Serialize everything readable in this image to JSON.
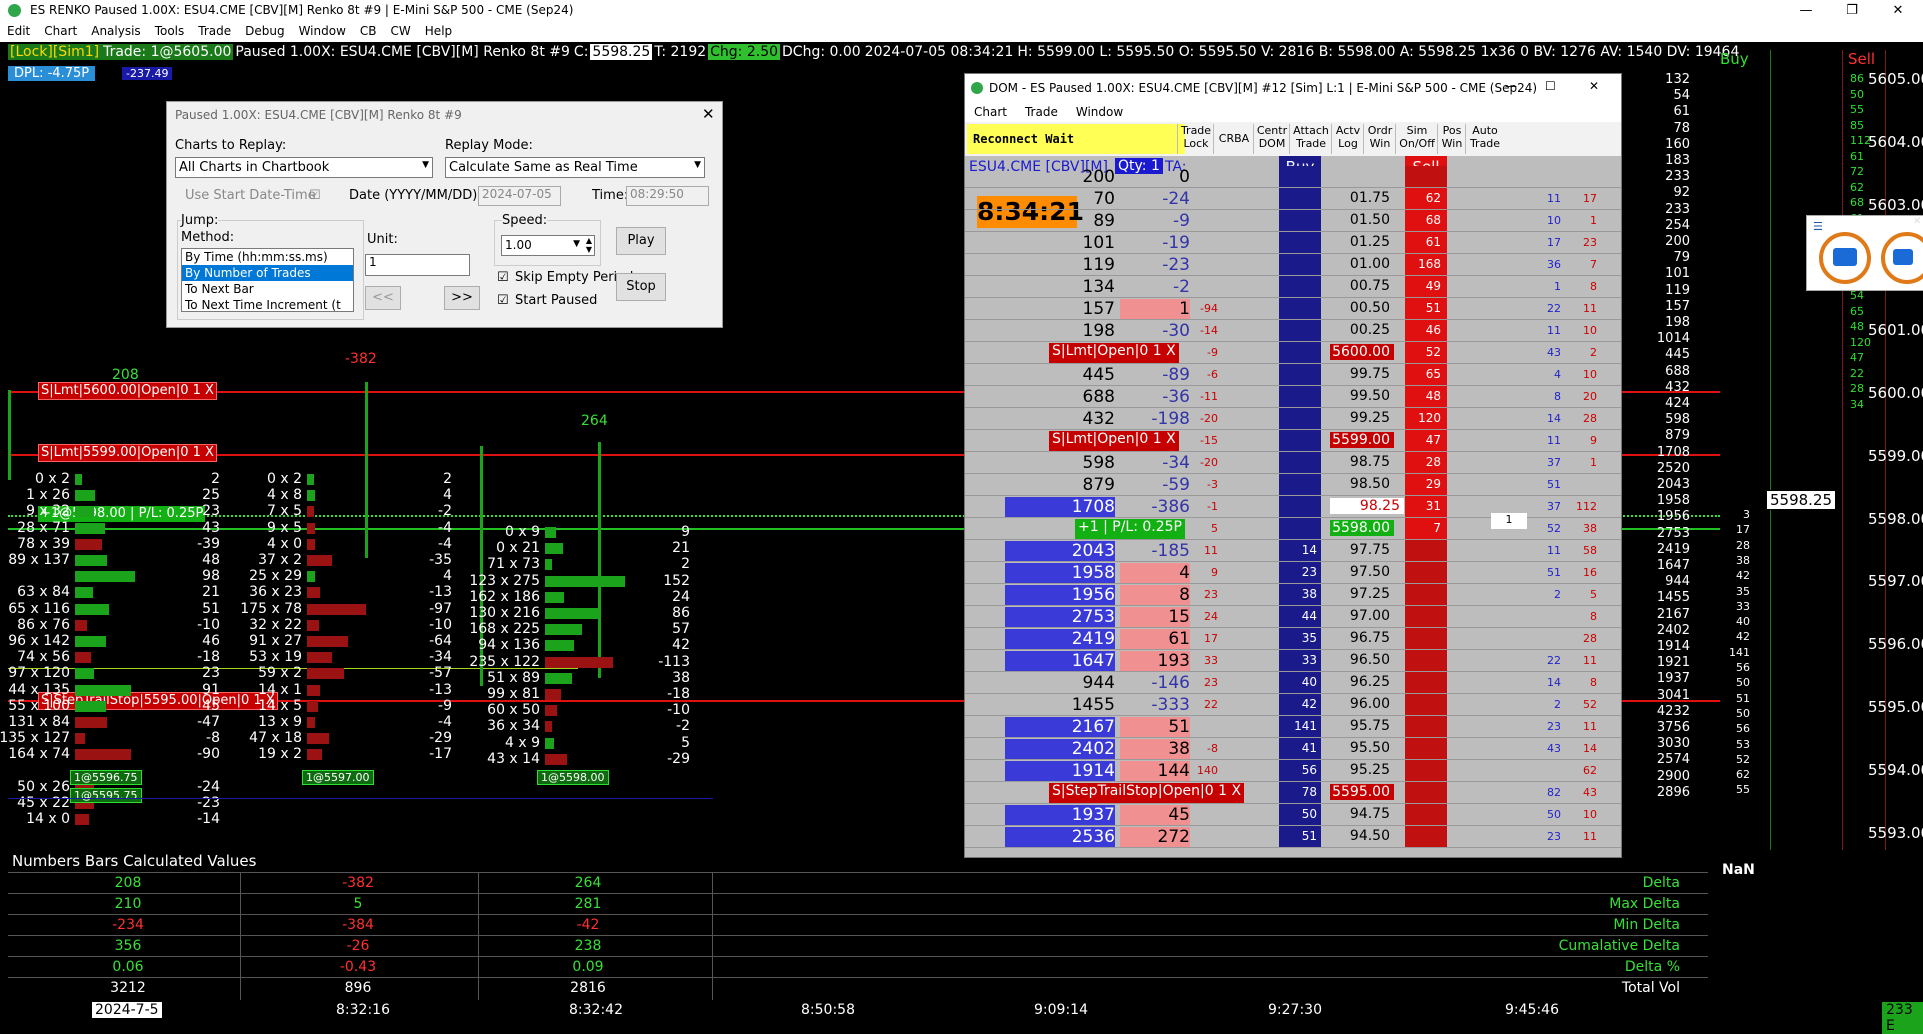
{
  "window": {
    "title": "ES RENKO Paused 1.00X: ESU4.CME [CBV][M]  Renko 8t #9 | E-Mini S&P 500 - CME (Sep24)",
    "minimize_glyph": "—",
    "restore_glyph": "❐",
    "close_glyph": "✕"
  },
  "menu": [
    "Edit",
    "Chart",
    "Analysis",
    "Tools",
    "Trade",
    "Debug",
    "Window",
    "CB",
    "CW",
    "Help"
  ],
  "status": {
    "lock": "[Lock][Sim1]",
    "trade": "Trade: 1@5605.00",
    "paused": "Paused 1.00X: ESU4.CME [CBV][M]  Renko 8t #9",
    "c_label": "C:",
    "c_val": "5598.25",
    "t_label": "T: 2192",
    "chg": "Chg: 2.50",
    "dchg": "DChg: 0.00",
    "datetime": "2024-07-05 08:34:21",
    "hlo": "H: 5599.00  L: 5595.50  O: 5595.50  V: 2816  B: 5598.00  A: 5598.25  1x36  0  BV: 1276  AV: 1540  DV: 19464",
    "dpl": "DPL: -4.75P",
    "dpl_val": "-237.49"
  },
  "replay": {
    "title": "Paused 1.00X: ESU4.CME [CBV][M]  Renko 8t #9",
    "charts_label": "Charts to Replay:",
    "charts_value": "All Charts in Chartbook",
    "mode_label": "Replay Mode:",
    "mode_value": "Calculate Same as Real Time",
    "use_start": "Use Start Date-Time",
    "date_label": "Date (YYYY/MM/DD):",
    "date_value": "2024-07-05",
    "time_label": "Time:",
    "time_value": "08:29:50",
    "jump_label": "Jump:",
    "method_label": "Method:",
    "methods": [
      "By Time (hh:mm:ss.ms)",
      "By Number of Trades",
      "To Next Bar",
      "To Next Time Increment (t"
    ],
    "unit_label": "Unit:",
    "unit_value": "1",
    "speed_label": "Speed:",
    "speed_value": "1.00",
    "skip_label": "Skip Empty Periods",
    "start_paused_label": "Start Paused",
    "play": "Play",
    "stop": "Stop",
    "back": "<<",
    "fwd": ">>"
  },
  "chart": {
    "delta_top": [
      "208",
      "-382",
      "264"
    ],
    "orders": [
      {
        "label": "S|Lmt|5600.00|Open|0  1  X"
      },
      {
        "label": "S|Lmt|5599.00|Open|0  1  X"
      },
      {
        "label": "+1@5598.00 | P/L: 0.25P"
      },
      {
        "label": "S|StepTrailStop|5595.00|Open|0  1  X"
      }
    ],
    "col1": [
      [
        "0 x 2",
        "2"
      ],
      [
        "1 x 26",
        "25"
      ],
      [
        "9 x 32",
        "23"
      ],
      [
        "28 x 71",
        "43"
      ],
      [
        "78 x 39",
        "-39"
      ],
      [
        "89 x 137",
        "48"
      ],
      [
        "",
        "98"
      ],
      [
        "63 x 84",
        "21"
      ],
      [
        "65 x 116",
        "51"
      ],
      [
        "86 x 76",
        "-10"
      ],
      [
        "96 x 142",
        "46"
      ],
      [
        "74 x 56",
        "-18"
      ],
      [
        "97 x 120",
        "23"
      ],
      [
        "44 x 135",
        "91"
      ],
      [
        "55 x 100",
        "45"
      ],
      [
        "131 x 84",
        "-47"
      ],
      [
        "135 x 127",
        "-8"
      ],
      [
        "164 x 74",
        "-90"
      ],
      [
        "",
        ""
      ],
      [
        "50 x 26",
        "-24"
      ],
      [
        "45 x 22",
        "-23"
      ],
      [
        "14 x 0",
        "-14"
      ]
    ],
    "col2": [
      [
        "0 x 2",
        "2"
      ],
      [
        "4 x 8",
        "4"
      ],
      [
        "7 x 5",
        "-2"
      ],
      [
        "9 x 5",
        "-4"
      ],
      [
        "4 x 0",
        "-4"
      ],
      [
        "37 x 2",
        "-35"
      ],
      [
        "25 x 29",
        "4"
      ],
      [
        "36 x 23",
        "-13"
      ],
      [
        "175 x 78",
        "-97"
      ],
      [
        "32 x 22",
        "-10"
      ],
      [
        "91 x 27",
        "-64"
      ],
      [
        "53 x 19",
        "-34"
      ],
      [
        "59 x 2",
        "-57"
      ],
      [
        "14 x 1",
        "-13"
      ],
      [
        "14 x 5",
        "-9"
      ],
      [
        "13 x 9",
        "-4"
      ],
      [
        "47 x 18",
        "-29"
      ],
      [
        "19 x 2",
        "-17"
      ]
    ],
    "col3": [
      [
        "0 x 9",
        "9"
      ],
      [
        "0 x 21",
        "21"
      ],
      [
        "71 x 73",
        "2"
      ],
      [
        "123 x 275",
        "152"
      ],
      [
        "162 x 186",
        "24"
      ],
      [
        "130 x 216",
        "86"
      ],
      [
        "168 x 225",
        "57"
      ],
      [
        "94 x 136",
        "42"
      ],
      [
        "235 x 122",
        "-113"
      ],
      [
        "51 x 89",
        "38"
      ],
      [
        "99 x 81",
        "-18"
      ],
      [
        "60 x 50",
        "-10"
      ],
      [
        "36 x 34",
        "-2"
      ],
      [
        "4 x 9",
        "5"
      ],
      [
        "43 x 14",
        "-29"
      ]
    ],
    "price_tags": [
      "1@5596.75",
      "1@5595.75",
      "1@5597.00",
      "1@5598.00"
    ]
  },
  "dom": {
    "title": "DOM - ES Paused 1.00X: ESU4.CME [CBV][M] #12 [Sim]  L:1 | E-Mini S&P 500 - CME (Sep24)",
    "menu": [
      "Chart",
      "Trade",
      "Window"
    ],
    "reconnect": "Reconnect Wait",
    "toolbar": [
      "Trade\nLock",
      "CRBA",
      "Centr\nDOM",
      "Attach\nTrade",
      "Actv\nLog",
      "Ordr\nWin",
      "Sim\nOn/Off",
      "Pos\nWin",
      "Auto\nTrade"
    ],
    "symbol": "ESU4.CME [CBV][M]",
    "qty": "Qty: 1",
    "ta": "TA:",
    "buy": "Buy",
    "sell": "Sell",
    "clock": "8:34:21",
    "rows": [
      {
        "v": "200",
        "d": "0",
        "x": "",
        "b": "",
        "p": "",
        "s": "",
        "n1": "",
        "n2": ""
      },
      {
        "v": "70",
        "d": "-24",
        "x": "",
        "b": "",
        "p": "01.75",
        "s": "62",
        "n1": "11",
        "n2": "17"
      },
      {
        "v": "89",
        "d": "-9",
        "x": "",
        "b": "",
        "p": "01.50",
        "s": "68",
        "n1": "10",
        "n2": "1"
      },
      {
        "v": "101",
        "d": "-19",
        "x": "",
        "b": "",
        "p": "01.25",
        "s": "61",
        "n1": "17",
        "n2": "23"
      },
      {
        "v": "119",
        "d": "-23",
        "x": "",
        "b": "",
        "p": "01.00",
        "s": "168",
        "n1": "36",
        "n2": "7"
      },
      {
        "v": "134",
        "d": "-2",
        "x": "",
        "b": "",
        "p": "00.75",
        "s": "49",
        "n1": "1",
        "n2": "8"
      },
      {
        "v": "157",
        "d": "1",
        "x": "-94",
        "b": "",
        "p": "00.50",
        "s": "51",
        "n1": "22",
        "n2": "11"
      },
      {
        "v": "198",
        "d": "-30",
        "x": "-14",
        "b": "",
        "p": "00.25",
        "s": "46",
        "n1": "11",
        "n2": "10"
      },
      {
        "v": "S|Lmt|Open|0  1  X",
        "d": "",
        "x": "-9",
        "b": "",
        "p": "5600.00",
        "s": "52",
        "n1": "43",
        "n2": "2"
      },
      {
        "v": "445",
        "d": "-89",
        "x": "-6",
        "b": "",
        "p": "99.75",
        "s": "65",
        "n1": "4",
        "n2": "10"
      },
      {
        "v": "688",
        "d": "-36",
        "x": "-11",
        "b": "",
        "p": "99.50",
        "s": "48",
        "n1": "8",
        "n2": "20"
      },
      {
        "v": "432",
        "d": "-198",
        "x": "-20",
        "b": "",
        "p": "99.25",
        "s": "120",
        "n1": "14",
        "n2": "28"
      },
      {
        "v": "S|Lmt|Open|0  1  X",
        "d": "",
        "x": "-15",
        "b": "",
        "p": "5599.00",
        "s": "47",
        "n1": "11",
        "n2": "9"
      },
      {
        "v": "598",
        "d": "-34",
        "x": "-20",
        "b": "",
        "p": "98.75",
        "s": "28",
        "n1": "37",
        "n2": "1"
      },
      {
        "v": "879",
        "d": "-59",
        "x": "-3",
        "b": "",
        "p": "98.50",
        "s": "29",
        "n1": "51",
        "n2": ""
      },
      {
        "v": "1708",
        "d": "-386",
        "x": "-1",
        "b": "",
        "p": "98.25",
        "s": "31",
        "n1": "37",
        "n2": "112"
      },
      {
        "v": "+1 | P/L: 0.25P",
        "d": "",
        "x": "5",
        "b": "",
        "p": "5598.00",
        "s": "7",
        "n1": "52",
        "n2": "38"
      },
      {
        "v": "2043",
        "d": "-185",
        "x": "11",
        "b": "14",
        "p": "97.75",
        "s": "",
        "n1": "11",
        "n2": "58"
      },
      {
        "v": "1958",
        "d": "4",
        "x": "9",
        "b": "23",
        "p": "97.50",
        "s": "",
        "n1": "51",
        "n2": "16"
      },
      {
        "v": "1956",
        "d": "8",
        "x": "23",
        "b": "38",
        "p": "97.25",
        "s": "",
        "n1": "2",
        "n2": "5"
      },
      {
        "v": "2753",
        "d": "15",
        "x": "24",
        "b": "44",
        "p": "97.00",
        "s": "",
        "n1": "",
        "n2": "8"
      },
      {
        "v": "2419",
        "d": "61",
        "x": "17",
        "b": "35",
        "p": "96.75",
        "s": "",
        "n1": "",
        "n2": "28"
      },
      {
        "v": "1647",
        "d": "193",
        "x": "33",
        "b": "33",
        "p": "96.50",
        "s": "",
        "n1": "22",
        "n2": "11"
      },
      {
        "v": "944",
        "d": "-146",
        "x": "23",
        "b": "40",
        "p": "96.25",
        "s": "",
        "n1": "14",
        "n2": "8"
      },
      {
        "v": "1455",
        "d": "-333",
        "x": "22",
        "b": "42",
        "p": "96.00",
        "s": "",
        "n1": "2",
        "n2": "52"
      },
      {
        "v": "2167",
        "d": "51",
        "x": "",
        "b": "141",
        "p": "95.75",
        "s": "",
        "n1": "23",
        "n2": "11"
      },
      {
        "v": "2402",
        "d": "38",
        "x": "-8",
        "b": "41",
        "p": "95.50",
        "s": "",
        "n1": "43",
        "n2": "14"
      },
      {
        "v": "1914",
        "d": "144",
        "x": "140",
        "b": "56",
        "p": "95.25",
        "s": "",
        "n1": "",
        "n2": "62"
      },
      {
        "v": "S|StepTrailStop|Open|0  1  X",
        "d": "",
        "x": "",
        "b": "78",
        "p": "5595.00",
        "s": "",
        "n1": "82",
        "n2": "43"
      },
      {
        "v": "1937",
        "d": "45",
        "x": "",
        "b": "50",
        "p": "94.75",
        "s": "",
        "n1": "50",
        "n2": "10"
      },
      {
        "v": "2536",
        "d": "272",
        "x": "",
        "b": "51",
        "p": "94.50",
        "s": "",
        "n1": "23",
        "n2": "11"
      }
    ],
    "pos_marker": "1"
  },
  "right_panel": {
    "buy": "Buy",
    "sell": "Sell",
    "vol_profile": [
      "132",
      "54",
      "61",
      "78",
      "160",
      "183",
      "233",
      "92",
      "233",
      "254",
      "200",
      "79",
      "101",
      "119",
      "157",
      "198",
      "1014",
      "445",
      "688",
      "432",
      "424",
      "598",
      "879",
      "1708",
      "2520",
      "2043",
      "1958",
      "1956",
      "2753",
      "2419",
      "1647",
      "944",
      "1455",
      "2167",
      "2402",
      "1914",
      "1921",
      "1937",
      "3041",
      "4232",
      "3756",
      "3030",
      "2574",
      "2900",
      "2896"
    ],
    "bid_col": [
      "3",
      "17",
      "28",
      "38",
      "42",
      "35",
      "33",
      "40",
      "42",
      "141",
      "56",
      "50",
      "51",
      "50",
      "56",
      "53",
      "52",
      "62",
      "55"
    ],
    "sell_col": [
      "86",
      "50",
      "55",
      "85",
      "112",
      "61",
      "72",
      "62",
      "68",
      "61",
      "168",
      "47",
      "48",
      "46",
      "54",
      "65",
      "48",
      "120",
      "47",
      "22",
      "28",
      "34"
    ],
    "prices": [
      "5605.00",
      "5604.00",
      "5603.00",
      "5602.00",
      "5601.00",
      "5600.00",
      "5599.00",
      "5598.00",
      "5597.00",
      "5596.00",
      "5595.00",
      "5594.00",
      "5593.00"
    ],
    "current_price": "5598.25",
    "nan": "NaN",
    "corner": "233 E"
  },
  "numbers_bars": {
    "title": "Numbers Bars Calculated Values",
    "rows": [
      {
        "label": "Delta",
        "vals": [
          "208",
          "-382",
          "264"
        ]
      },
      {
        "label": "Max Delta",
        "vals": [
          "210",
          "5",
          "281"
        ]
      },
      {
        "label": "Min Delta",
        "vals": [
          "-234",
          "-384",
          "-42"
        ]
      },
      {
        "label": "Cumalative Delta",
        "vals": [
          "356",
          "-26",
          "238"
        ]
      },
      {
        "label": "Delta %",
        "vals": [
          "0.06",
          "-0.43",
          "0.09"
        ]
      },
      {
        "label": "Total Vol",
        "vals": [
          "3212",
          "896",
          "2816"
        ]
      }
    ]
  },
  "time_axis": [
    "2024-7-5",
    "8:32:16",
    "8:32:42",
    "8:50:58",
    "9:09:14",
    "9:27:30",
    "9:45:46"
  ],
  "colors": {
    "accent_green": "#1ca31c",
    "accent_red": "#c60000",
    "dom_blue": "#1a1a8a",
    "price_red": "#ff1a1a"
  }
}
